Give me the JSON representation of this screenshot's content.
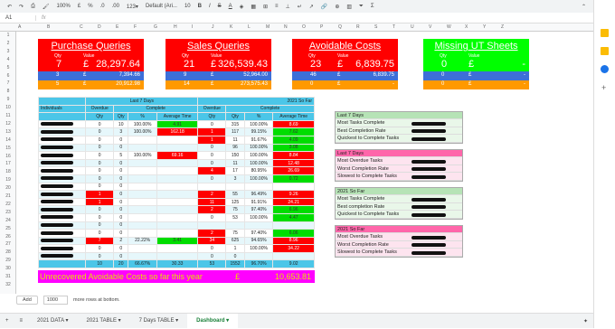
{
  "toolbar": {
    "zoom": "100%",
    "currency": "£",
    "percent": "%",
    "dec1": ".0",
    "dec2": ".00",
    "num_format": "123▾",
    "font": "Default (Ari...",
    "font_size": "10"
  },
  "cell_ref": "A1",
  "fx": "fx",
  "columns": [
    "A",
    "B",
    "C",
    "D",
    "E",
    "F",
    "G",
    "H",
    "I",
    "J",
    "K",
    "L",
    "M",
    "N",
    "O",
    "P",
    "Q",
    "R",
    "S",
    "T",
    "U",
    "V",
    "W",
    "X",
    "Y",
    "Z"
  ],
  "rows": [
    "1",
    "2",
    "3",
    "4",
    "5",
    "6",
    "7",
    "8",
    "9",
    "10",
    "11",
    "12",
    "13",
    "14",
    "15",
    "16",
    "17",
    "18",
    "19",
    "20",
    "21",
    "22",
    "23",
    "24",
    "25",
    "26",
    "27",
    "28",
    "29",
    "30",
    "31",
    "32"
  ],
  "cards": [
    {
      "title": "Purchase Queries",
      "qty_label": "Qty",
      "value_label": "Value",
      "qty": "7",
      "currency": "£",
      "value": "28,297.64",
      "row2": [
        "3",
        "£",
        "7,394.66"
      ],
      "row3": [
        "5",
        "£",
        "20,912.98"
      ],
      "color": "#ff0000"
    },
    {
      "title": "Sales Queries",
      "qty_label": "Qty",
      "value_label": "Value",
      "qty": "21",
      "currency": "£",
      "value": "326,539.43",
      "row2": [
        "9",
        "£",
        "52,964.00"
      ],
      "row3": [
        "14",
        "£",
        "273,575.43"
      ],
      "color": "#ff0000"
    },
    {
      "title": "Avoidable Costs",
      "qty_label": "Qty",
      "value_label": "Value",
      "qty": "23",
      "currency": "£",
      "value": "6,839.75",
      "row2": [
        "46",
        "£",
        "6,839.75"
      ],
      "row3": [
        "0",
        "£",
        "-"
      ],
      "color": "#ff0000"
    },
    {
      "title": "Missing UT Sheets",
      "qty_label": "Qty",
      "value_label": "Value",
      "qty": "0",
      "currency": "£",
      "value": "-",
      "row2": [
        "0",
        "£",
        "-"
      ],
      "row3": [
        "0",
        "£",
        "-"
      ],
      "color": "#00ff00"
    }
  ],
  "table": {
    "hdr_last7": "Last 7 Days",
    "hdr_sofar": "2021 So Far",
    "hdr_individuals": "Individuals",
    "hdr_overdue": "Overdue",
    "hdr_complete": "Complete",
    "hdr_qty": "Qty",
    "hdr_pct": "%",
    "hdr_avg": "Average Time",
    "rows": [
      [
        "0",
        "10",
        "100.00%",
        "4.91",
        "0",
        "315",
        "100.00%",
        "8.69"
      ],
      [
        "0",
        "3",
        "100.00%",
        "162.18",
        "1",
        "117",
        "99.15%",
        "7.62"
      ],
      [
        "0",
        "0",
        "",
        "",
        "1",
        "11",
        "91.67%",
        "4.09"
      ],
      [
        "0",
        "0",
        "",
        "",
        "0",
        "96",
        "100.00%",
        "3.08"
      ],
      [
        "0",
        "5",
        "100.00%",
        "69.16",
        "0",
        "150",
        "100.00%",
        "8.84"
      ],
      [
        "0",
        "0",
        "",
        "",
        "0",
        "11",
        "100.00%",
        "12.48"
      ],
      [
        "0",
        "0",
        "",
        "",
        "4",
        "17",
        "80.95%",
        "26.69"
      ],
      [
        "0",
        "0",
        "",
        "",
        "0",
        "3",
        "100.00%",
        "0.72"
      ],
      [
        "0",
        "0",
        "",
        "",
        "",
        "",
        "",
        ""
      ],
      [
        "1",
        "0",
        "",
        "",
        "2",
        "55",
        "96.49%",
        "9.26"
      ],
      [
        "1",
        "0",
        "",
        "",
        "11",
        "125",
        "91.91%",
        "24.21"
      ],
      [
        "0",
        "0",
        "",
        "",
        "2",
        "75",
        "97.40%",
        "6.96"
      ],
      [
        "0",
        "0",
        "",
        "",
        "0",
        "53",
        "100.00%",
        "4.47"
      ],
      [
        "0",
        "0",
        "",
        "",
        "",
        "",
        "",
        ""
      ],
      [
        "0",
        "0",
        "",
        "",
        "2",
        "75",
        "97.40%",
        "6.06"
      ],
      [
        "7",
        "2",
        "22.22%",
        "3.41",
        "34",
        "625",
        "94.65%",
        "8.96"
      ],
      [
        "0",
        "0",
        "",
        "",
        "0",
        "1",
        "100.00%",
        "34.22"
      ],
      [
        "0",
        "0",
        "",
        "",
        "0",
        "0",
        "",
        ""
      ]
    ],
    "totals": [
      "10",
      "20",
      "66.67%",
      "30.33",
      "53",
      "1552",
      "96.70%",
      "9.02"
    ]
  },
  "banner": {
    "text": "Unrecovered Avoidable Costs so far this year",
    "currency": "£",
    "value": "10,653.81"
  },
  "side": [
    {
      "header": "Last 7 Days",
      "color": "#b6e3b6",
      "items": [
        "Most Tasks Complete",
        "Best Completion Rate",
        "Quickest to Complete Tasks"
      ]
    },
    {
      "header": "Last 7 Days",
      "color": "#ff66aa",
      "items": [
        "Most Overdue Tasks",
        "Worst Completion Rate",
        "Slowest to Complete Tasks"
      ]
    },
    {
      "header": "2021 So Far",
      "color": "#b6e3b6",
      "items": [
        "Most Tasks Complete",
        "Best completion Rate",
        "Quickest to Complete Tasks"
      ]
    },
    {
      "header": "2021 So Far",
      "color": "#ff66aa",
      "items": [
        "Most Overdue Tasks",
        "Worst Completion Rate",
        "Slowest to Complete Tasks"
      ]
    }
  ],
  "footer": {
    "add": "Add",
    "rows": "1000",
    "more": "more rows at bottom."
  },
  "tabs": [
    "2021 DATA",
    "2021 TABLE",
    "7 Days TABLE",
    "Dashboard"
  ]
}
